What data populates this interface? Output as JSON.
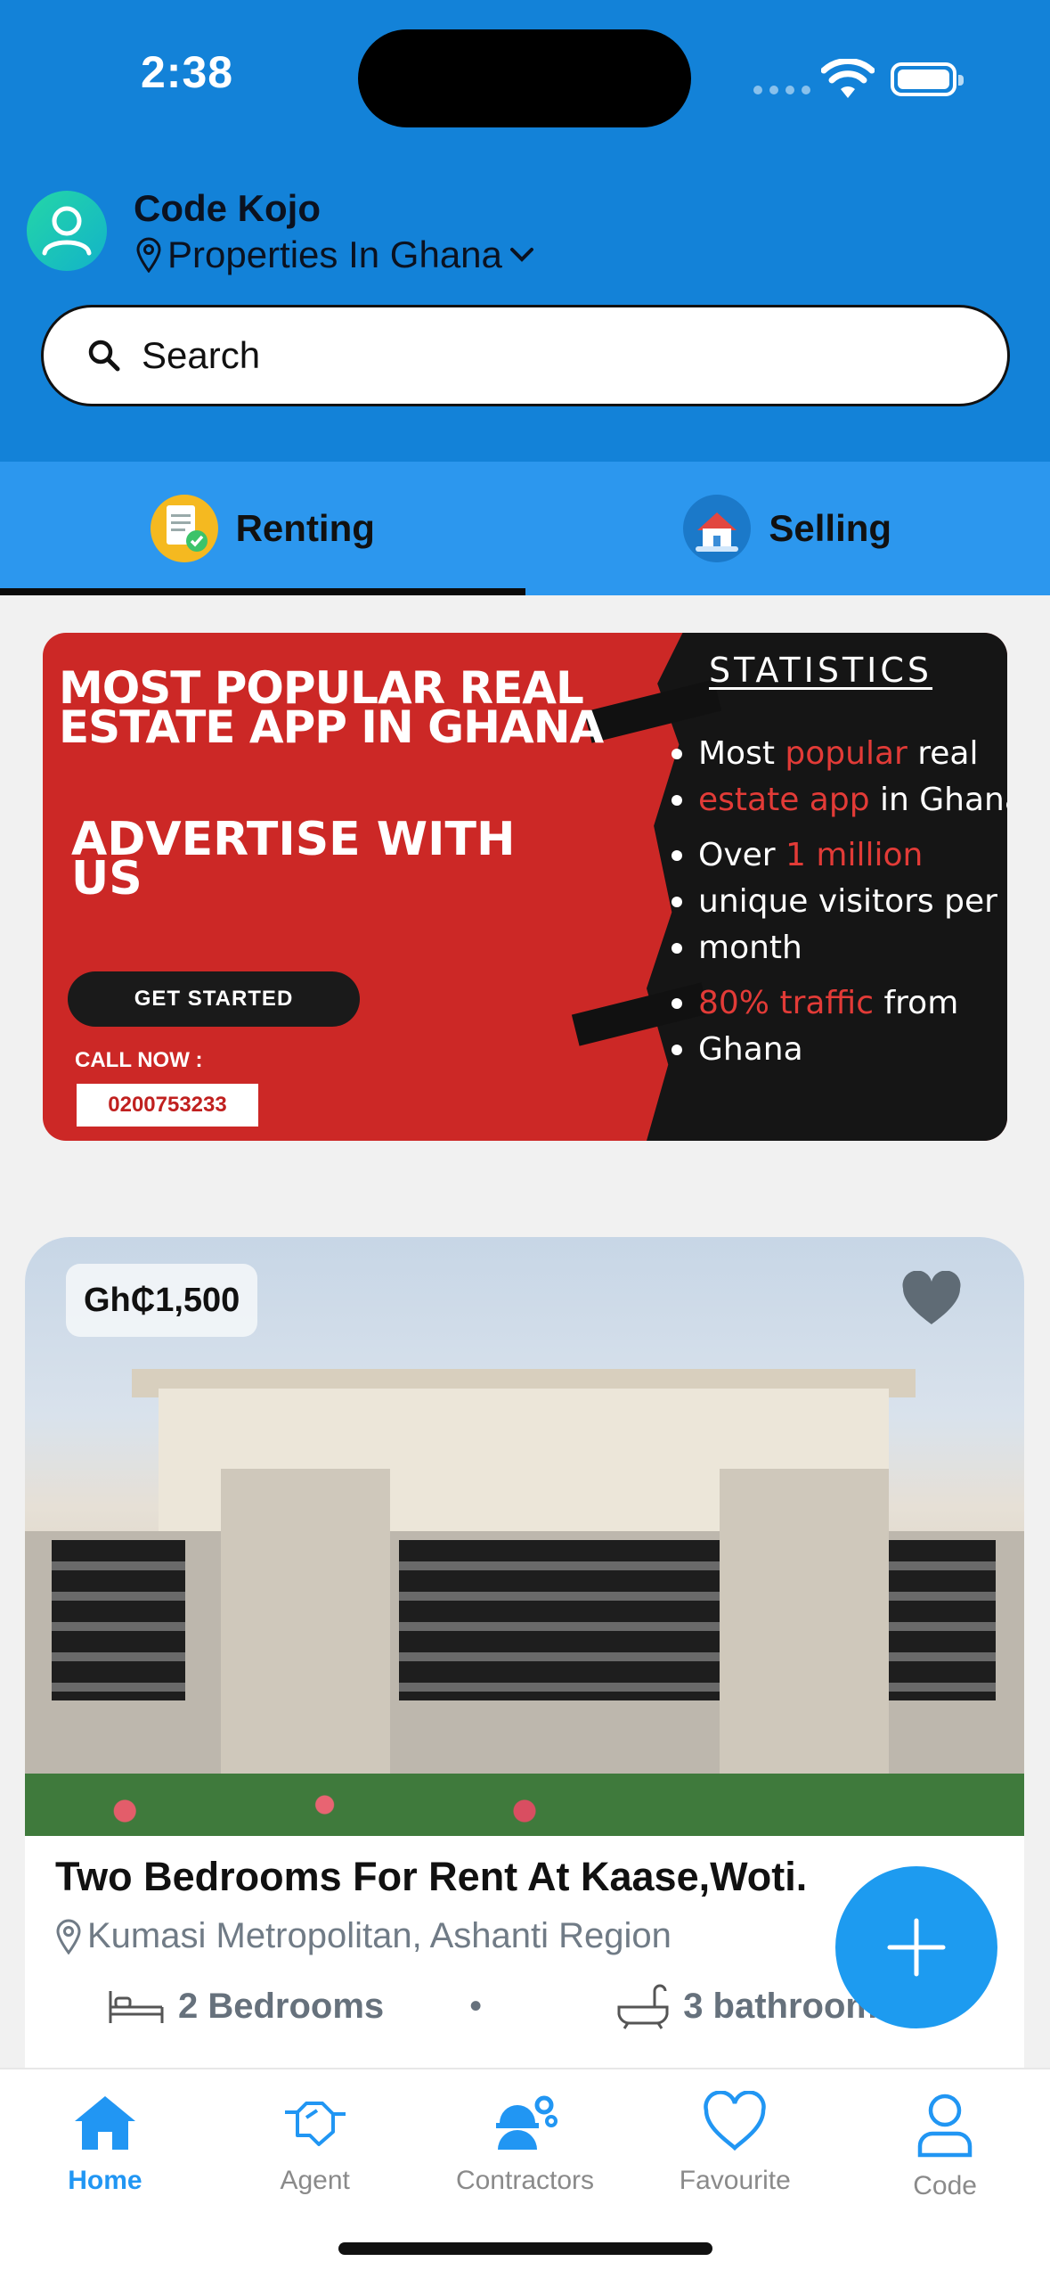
{
  "status_bar": {
    "time": "2:38"
  },
  "header": {
    "user_name": "Code Kojo",
    "location": "Properties In Ghana",
    "search_placeholder": "Search"
  },
  "tabs": [
    {
      "label": "Renting",
      "icon": "rent-document-icon",
      "active": true
    },
    {
      "label": "Selling",
      "icon": "house-for-sale-icon",
      "active": false
    }
  ],
  "banner": {
    "headline": "MOST POPULAR REAL ESTATE APP IN GHANA",
    "advertise": "ADVERTISE WITH US",
    "cta": "GET STARTED",
    "call_now": "CALL NOW :",
    "phone": "0200753233",
    "stats_title": "STATISTICS",
    "stats": [
      {
        "pre": "Most ",
        "hl": "popular",
        "post": " real"
      },
      {
        "pre": "",
        "hl": "estate app",
        "post": " in Ghana"
      },
      {
        "pre": "Over ",
        "hl": "1 million",
        "post": ""
      },
      {
        "pre": "unique visitors per",
        "hl": "",
        "post": ""
      },
      {
        "pre": "month",
        "hl": "",
        "post": ""
      },
      {
        "pre": "",
        "hl": "80% traffic",
        "post": " from"
      },
      {
        "pre": "Ghana",
        "hl": "",
        "post": ""
      }
    ]
  },
  "listing": {
    "price": "Gh₵1,500",
    "title": "Two Bedrooms For Rent At Kaase,Woti.",
    "location": "Kumasi Metropolitan, Ashanti Region",
    "bedrooms": "2 Bedrooms",
    "separator": "•",
    "bathrooms": "3 bathrooms"
  },
  "bottom_nav": [
    {
      "label": "Home",
      "active": true
    },
    {
      "label": "Agent",
      "active": false
    },
    {
      "label": "Contractors",
      "active": false
    },
    {
      "label": "Favourite",
      "active": false
    },
    {
      "label": "Code",
      "active": false
    }
  ],
  "colors": {
    "header_blue": "#1382d8",
    "tab_blue": "#2c97ee",
    "accent": "#2196f3",
    "banner_red": "#cc2826"
  }
}
